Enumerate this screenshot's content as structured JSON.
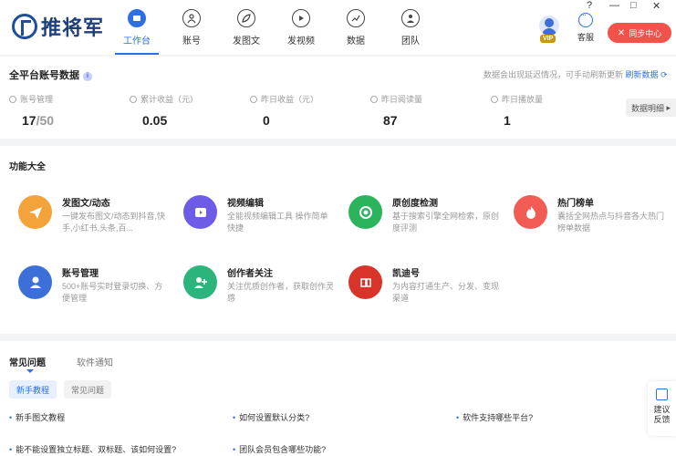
{
  "app": {
    "logo_text": "推将军"
  },
  "nav": [
    {
      "label": "工作台",
      "icon": "dashboard-icon",
      "active": true
    },
    {
      "label": "账号",
      "icon": "user-icon",
      "active": false
    },
    {
      "label": "发图文",
      "icon": "leaf-icon",
      "active": false
    },
    {
      "label": "发视频",
      "icon": "play-icon",
      "active": false
    },
    {
      "label": "数据",
      "icon": "chart-icon",
      "active": false
    },
    {
      "label": "团队",
      "icon": "team-icon",
      "active": false
    }
  ],
  "header": {
    "vip_badge": "VIP",
    "service_label": "客服",
    "sync_label": "同步中心",
    "window_controls": [
      "?",
      "—",
      "□",
      "✕"
    ]
  },
  "stats": {
    "title": "全平台账号数据",
    "note": "数据会出现延迟情况，可手动刷新更新",
    "refresh_label": "刷新数据",
    "detail_label": "数据明细",
    "items": [
      {
        "label": "账号管理",
        "value": "17",
        "suffix": "/50"
      },
      {
        "label": "累计收益（元）",
        "value": "0.05",
        "suffix": ""
      },
      {
        "label": "昨日收益（元）",
        "value": "0",
        "suffix": ""
      },
      {
        "label": "昨日阅读量",
        "value": "87",
        "suffix": ""
      },
      {
        "label": "昨日播放量",
        "value": "1",
        "suffix": ""
      }
    ]
  },
  "features": {
    "title": "功能大全",
    "items": [
      {
        "title": "发图文/动态",
        "desc": "一键发布图文/动态到抖音,快手,小红书,头条,百...",
        "icon": "paper-plane-icon",
        "color": "#f4a23a"
      },
      {
        "title": "视频编辑",
        "desc": "全能视频编辑工具 操作简单快捷",
        "icon": "video-edit-icon",
        "color": "#6c5ce7"
      },
      {
        "title": "原创度检测",
        "desc": "基于搜索引擎全网检索，原创度评测",
        "icon": "target-icon",
        "color": "#2bb45b"
      },
      {
        "title": "热门榜单",
        "desc": "囊括全网热点与抖音各大热门榜单数据",
        "icon": "fire-icon",
        "color": "#f25c54"
      },
      {
        "title": "账号管理",
        "desc": "500+账号实时登录切换、方便管理",
        "icon": "account-icon",
        "color": "#3d6fd8"
      },
      {
        "title": "创作者关注",
        "desc": "关注优质创作者，获取创作灵感",
        "icon": "follow-icon",
        "color": "#2bb47b"
      },
      {
        "title": "凯迪号",
        "desc": "为内容打通生产、分发、变现渠道",
        "icon": "kaidi-logo-icon",
        "color": "#d8342a"
      }
    ]
  },
  "faq": {
    "tabs": [
      "常见问题",
      "软件通知"
    ],
    "chips": [
      "新手教程",
      "常见问题"
    ],
    "questions": [
      "新手图文教程",
      "如何设置默认分类?",
      "软件支持哪些平台?",
      "能不能设置独立标题、双标题、该如何设置?",
      "团队会员包含哪些功能?"
    ]
  },
  "float_button": {
    "label": "建议反馈"
  }
}
